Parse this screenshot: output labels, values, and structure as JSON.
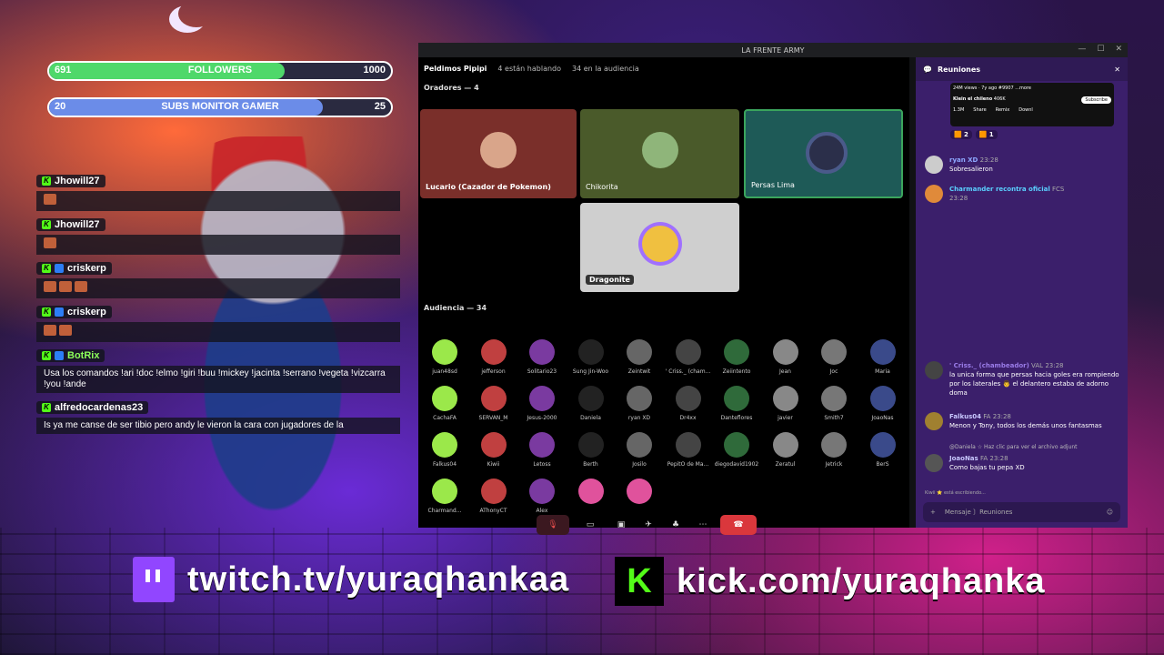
{
  "overlay": {
    "followers": {
      "current": "691",
      "label": "FOLLOWERS",
      "goal": "1000",
      "progress": 0.69,
      "color": "#4fd86a"
    },
    "subs": {
      "current": "20",
      "label": "SUBS MONITOR GAMER",
      "goal": "25",
      "progress": 0.8,
      "color": "#6b8ce8"
    },
    "chat": [
      {
        "user": "Jhowill27",
        "text": ""
      },
      {
        "user": "Jhowill27",
        "text": ""
      },
      {
        "user": "criskerp",
        "text": ""
      },
      {
        "user": "criskerp",
        "text": ""
      },
      {
        "user": "BotRix",
        "text": "Usa los comandos !ari !doc !elmo !giri !buu !mickey !jacinta !serrano !vegeta !vizcarra !you !ande"
      },
      {
        "user": "alfredocardenas23",
        "text": "Is ya me canse de ser tibio pero andy le vieron la cara con jugadores de la"
      }
    ],
    "links": {
      "twitch": "twitch.tv/yuraqhankaa",
      "kick": "kick.com/yuraqhanka",
      "kick_glyph": "K"
    }
  },
  "discord": {
    "title": "LA FRENTE ARMY",
    "channel": {
      "name": "Peldimos Pipipi",
      "speaking": "4 están hablando",
      "audience": "34 en la audiencia"
    },
    "speakers_header": "Oradores — 4",
    "speakers": [
      {
        "label": "Lucario (Cazador de Pokemon)",
        "bg": "#7a2f2a"
      },
      {
        "label": "Chikorita",
        "bg": "#4a5a2a"
      },
      {
        "label": "Persas Lima",
        "bg": "#1e5a57"
      },
      {
        "label": "Dragonite",
        "bg": "#cfcfcf"
      }
    ],
    "audience_header": "Audiencia — 34",
    "audience": [
      "juan48sd",
      "jefferson",
      "Solitario23",
      "Sung Jin-Woo",
      "Zeintwit",
      "' Criss._ (cham...",
      "Zeiintento",
      "Jean",
      "Joc",
      "Maria",
      "CachaFA",
      "SERVAN_M",
      "Jesus-2000",
      "Daniela",
      "ryan XD",
      "Dr4xx",
      "Danteflores",
      "javier",
      "Smith7",
      "JoaoNas",
      "Falkus04",
      "Kiwii",
      "Letoss",
      "Berth",
      "Josilo",
      "PepitO de Ma...",
      "diegodavid1902",
      "Zeratul",
      "Jetrick",
      "BerS",
      "Charmand...",
      "AThonyCT",
      "Alex",
      "",
      ""
    ],
    "panel": {
      "title": "Reuniones",
      "embed": {
        "views": "24M views · 7y ago  #9907  ...more",
        "channel": "Klein el chileno",
        "subs": "406K",
        "subscribe": "Subscribe",
        "likes": "1.3M",
        "share": "Share",
        "remix": "Remix",
        "download": "Downl"
      },
      "reactions": [
        "2",
        "1"
      ],
      "messages": [
        {
          "user": "ryan XD",
          "time": "23:28",
          "text": "Sobresalieron",
          "color": "#8ea8ff"
        },
        {
          "user": "Charmander recontra oficial",
          "tag": "FCS",
          "time": "23:28",
          "text": "",
          "color": "#5ad0ff"
        },
        {
          "user": "' Criss._ (chambeador)",
          "tag": "VAL",
          "time": "23:28",
          "text": "la unica forma que persas hacia goles era rompiendo por los laterales 👨 el delantero estaba de adorno doma",
          "color": "#9a7ce8"
        },
        {
          "user": "Falkus04",
          "tag": "FA",
          "time": "23:28",
          "text": "Menon y Tony, todos los demás unos fantasmas",
          "color": "#c9c9ff"
        },
        {
          "user": "JoaoNas",
          "tag": "FA",
          "time": "23:28",
          "text": "Como bajas  tu pepa XD",
          "color": "#c9c9ff"
        }
      ],
      "reply_hint": "@Daniela ☆ Haz clic para ver el archivo adjunt",
      "typing": "Kiwii ⭐ está escribiendo...",
      "composer_placeholder": "Mensaje   〕Reuniones"
    }
  }
}
